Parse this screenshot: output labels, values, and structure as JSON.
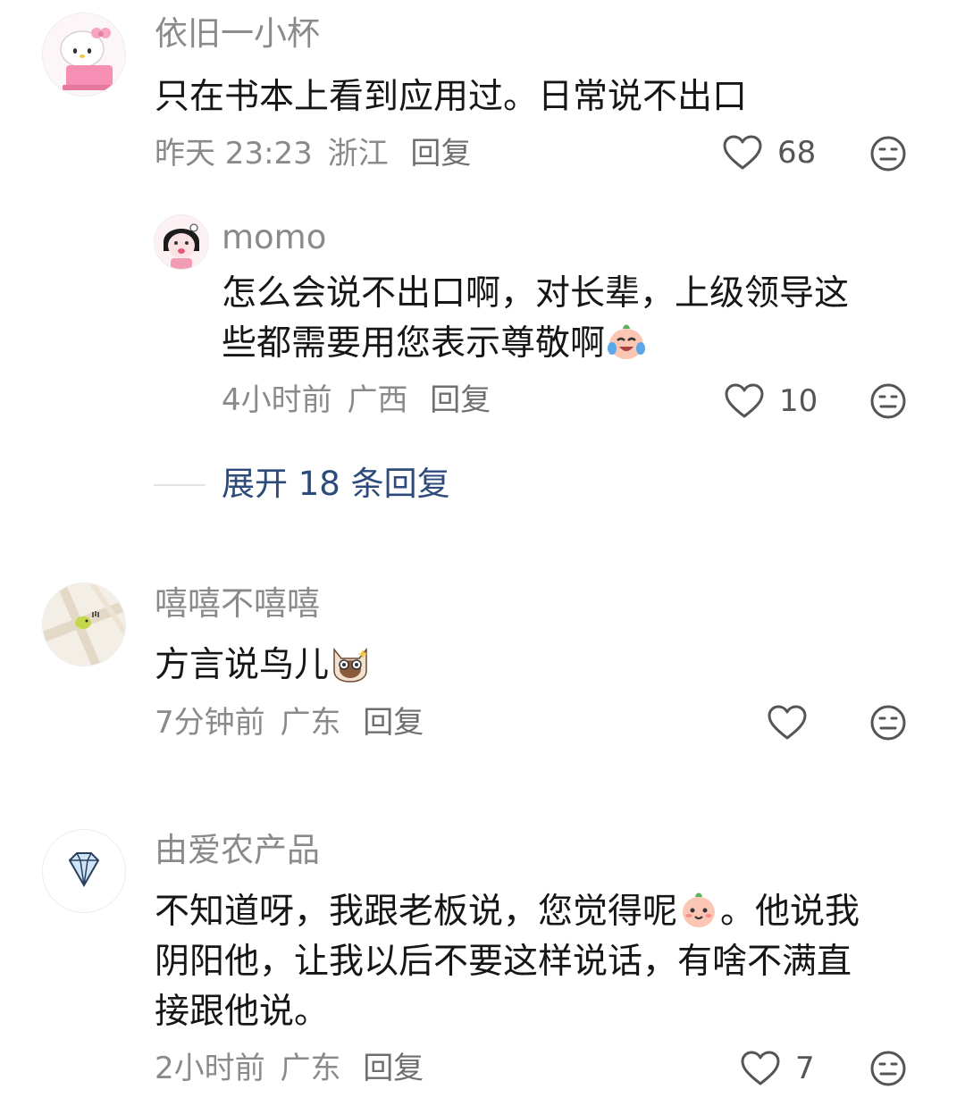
{
  "comments": [
    {
      "username": "依旧一小杯",
      "text": "只在书本上看到应用过。日常说不出口",
      "time": "昨天 23:23",
      "location": "浙江",
      "reply_label": "回复",
      "likes": "68",
      "avatar_icon": "hello-kitty-avatar-icon"
    },
    {
      "username": "嘻嘻不嘻嘻",
      "text": "方言说鸟儿",
      "time": "7分钟前",
      "location": "广东",
      "reply_label": "回复",
      "likes": "",
      "avatar_icon": "map-chick-avatar-icon"
    },
    {
      "username": "由爱农产品",
      "text_line1": "不知道呀，我跟老板说，您觉得呢",
      "text_line1b": "。他说我",
      "text_line2": "阴阳他，让我以后不要这样说话，有啥不满直",
      "text_line3": "接跟他说。",
      "time": "2小时前",
      "location": "广东",
      "reply_label": "回复",
      "likes": "7",
      "avatar_icon": "diamond-avatar-icon"
    }
  ],
  "reply": {
    "username": "momo",
    "text_line1": "怎么会说不出口啊，对长辈，上级领导这",
    "text_line2": "些都需要用您表示尊敬啊",
    "time": "4小时前",
    "location": "广西",
    "reply_label": "回复",
    "likes": "10",
    "avatar_icon": "cartoon-girl-avatar-icon"
  },
  "expand_replies": "展开 18 条回复",
  "colors": {
    "username": "#8a8a8a",
    "text": "#161616",
    "meta": "#8a8a8a",
    "expand_link": "#2c4a7a"
  }
}
